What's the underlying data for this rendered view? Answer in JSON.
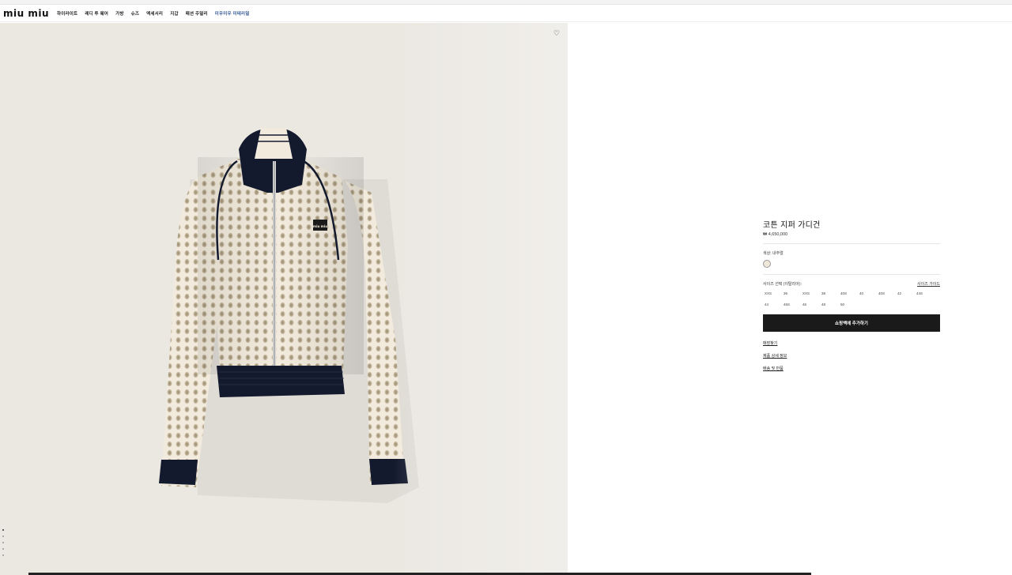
{
  "header": {
    "logo": "miu miu",
    "nav": [
      "하이라이트",
      "레디 투 웨어",
      "가방",
      "슈즈",
      "액세서리",
      "지갑",
      "패션 주얼리",
      "미우미우 미테리얼"
    ]
  },
  "gallery": {
    "wishlist_icon": "heart-icon",
    "dot_count": 5,
    "patch_text": "miu miu"
  },
  "product": {
    "name": "코튼 지퍼 가디건",
    "price": "₩ 4,650,000",
    "color_label": "색상: 내추럴",
    "size_label": "사이즈 선택 (이탈리아):",
    "size_guide": "사이즈 가이드",
    "sizes_row1": [
      "XXS",
      "36",
      "XXS",
      "38",
      "40S",
      "40",
      "40S",
      "42",
      "44S"
    ],
    "sizes_row2": [
      "44",
      "46S",
      "46",
      "48",
      "50"
    ],
    "add_to_bag": "쇼핑백에 추가하기",
    "links": [
      "매장찾기",
      "제품 상세 정보",
      "배송 및 반품"
    ]
  },
  "colors": {
    "image_bg": "#ebe8e2",
    "button": "#1a1a1a",
    "accent_nav": "#3a5d9a",
    "knit": "#f2ebdd",
    "navy": "#141a2e"
  }
}
